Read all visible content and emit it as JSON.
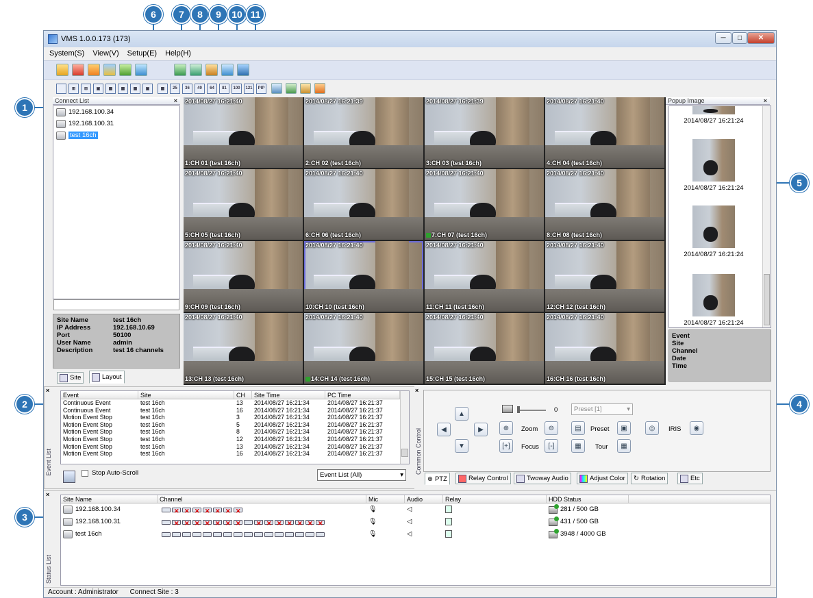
{
  "window": {
    "title": "VMS 1.0.0.173 (173)"
  },
  "menu": [
    "System(S)",
    "View(V)",
    "Setup(E)",
    "Help(H)"
  ],
  "callouts": [
    "1",
    "2",
    "3",
    "4",
    "5",
    "6",
    "7",
    "8",
    "9",
    "10",
    "11"
  ],
  "layout_buttons": [
    "25",
    "36",
    "49",
    "64",
    "81",
    "100",
    "121",
    "PIP"
  ],
  "connect_list": {
    "title": "Connect List",
    "items": [
      "192.168.100.34",
      "192.168.100.31",
      "test 16ch"
    ],
    "selected": "test 16ch"
  },
  "site_info": {
    "labels": [
      "Site Name",
      "IP Address",
      "Port",
      "User Name",
      "Description"
    ],
    "values": [
      "test 16ch",
      "192.168.10.69",
      "50100",
      "admin",
      "test 16 channels"
    ]
  },
  "left_tabs": [
    "Site",
    "Layout"
  ],
  "cameras": [
    {
      "ts": "2014/08/27 16:21:40",
      "label": "1:CH 01 (test 16ch)",
      "rec": false
    },
    {
      "ts": "2014/08/27 16:21:39",
      "label": "2:CH 02 (test 16ch)",
      "rec": false
    },
    {
      "ts": "2014/08/27 16:21:39",
      "label": "3:CH 03 (test 16ch)",
      "rec": false
    },
    {
      "ts": "2014/08/27 16:21:40",
      "label": "4:CH 04 (test 16ch)",
      "rec": false
    },
    {
      "ts": "2014/08/27 16:21:40",
      "label": "5:CH 05 (test 16ch)",
      "rec": false
    },
    {
      "ts": "2014/08/27 16:21:40",
      "label": "6:CH 06 (test 16ch)",
      "rec": false
    },
    {
      "ts": "2014/08/27 16:21:40",
      "label": "7:CH 07 (test 16ch)",
      "rec": true
    },
    {
      "ts": "2014/08/27 16:21:40",
      "label": "8:CH 08 (test 16ch)",
      "rec": false
    },
    {
      "ts": "2014/08/27 16:21:40",
      "label": "9:CH 09 (test 16ch)",
      "rec": false
    },
    {
      "ts": "2014/08/27 16:21:40",
      "label": "10:CH 10 (test 16ch)",
      "rec": false
    },
    {
      "ts": "2014/08/27 16:21:40",
      "label": "11:CH 11 (test 16ch)",
      "rec": false
    },
    {
      "ts": "2014/08/27 16:21:40",
      "label": "12:CH 12 (test 16ch)",
      "rec": false
    },
    {
      "ts": "2014/08/27 16:21:40",
      "label": "13:CH 13 (test 16ch)",
      "rec": false
    },
    {
      "ts": "2014/08/27 16:21:40",
      "label": "14:CH 14 (test 16ch)",
      "rec": true
    },
    {
      "ts": "2014/08/27 16:21:40",
      "label": "15:CH 15 (test 16ch)",
      "rec": false
    },
    {
      "ts": "2014/08/27 16:21:40",
      "label": "16:CH 16 (test 16ch)",
      "rec": false
    }
  ],
  "popup": {
    "title": "Popup Image",
    "items": [
      "2014/08/27 16:21:24",
      "2014/08/27 16:21:24",
      "2014/08/27 16:21:24",
      "2014/08/27 16:21:24"
    ],
    "info_labels": [
      "Event",
      "Site",
      "Channel",
      "Date",
      "Time"
    ]
  },
  "event_list": {
    "side_label": "Event List",
    "columns": [
      "Event",
      "Site",
      "CH",
      "Site Time",
      "PC Time"
    ],
    "rows": [
      [
        "Continuous Event",
        "test 16ch",
        "13",
        "2014/08/27 16:21:34",
        "2014/08/27 16:21:37"
      ],
      [
        "Continuous Event",
        "test 16ch",
        "16",
        "2014/08/27 16:21:34",
        "2014/08/27 16:21:37"
      ],
      [
        "Motion Event Stop",
        "test 16ch",
        "3",
        "2014/08/27 16:21:34",
        "2014/08/27 16:21:37"
      ],
      [
        "Motion Event Stop",
        "test 16ch",
        "5",
        "2014/08/27 16:21:34",
        "2014/08/27 16:21:37"
      ],
      [
        "Motion Event Stop",
        "test 16ch",
        "8",
        "2014/08/27 16:21:34",
        "2014/08/27 16:21:37"
      ],
      [
        "Motion Event Stop",
        "test 16ch",
        "12",
        "2014/08/27 16:21:34",
        "2014/08/27 16:21:37"
      ],
      [
        "Motion Event Stop",
        "test 16ch",
        "13",
        "2014/08/27 16:21:34",
        "2014/08/27 16:21:37"
      ],
      [
        "Motion Event Stop",
        "test 16ch",
        "16",
        "2014/08/27 16:21:34",
        "2014/08/27 16:21:37"
      ]
    ],
    "stop_auto_scroll": "Stop Auto-Scroll",
    "filter": "Event List (All)"
  },
  "control": {
    "side_label": "Common Control",
    "speed_value": "0",
    "preset_select": "Preset [1]",
    "labels": {
      "zoom": "Zoom",
      "focus": "Focus",
      "preset": "Preset",
      "tour": "Tour",
      "iris": "IRIS"
    },
    "tabs": [
      "PTZ",
      "Relay Control",
      "Twoway Audio",
      "Adjust Color",
      "Rotation",
      "Etc"
    ]
  },
  "status_list": {
    "side_label": "Status List",
    "columns": [
      "Site Name",
      "Channel",
      "Mic",
      "Audio",
      "Relay",
      "HDD Status"
    ],
    "rows": [
      {
        "site": "192.168.100.34",
        "hdd": "281 / 500 GB"
      },
      {
        "site": "192.168.100.31",
        "hdd": "431 / 500 GB"
      },
      {
        "site": "test 16ch",
        "hdd": "3948 / 4000 GB"
      }
    ]
  },
  "statusbar": {
    "account": "Account : Administrator",
    "connect": "Connect Site : 3"
  }
}
